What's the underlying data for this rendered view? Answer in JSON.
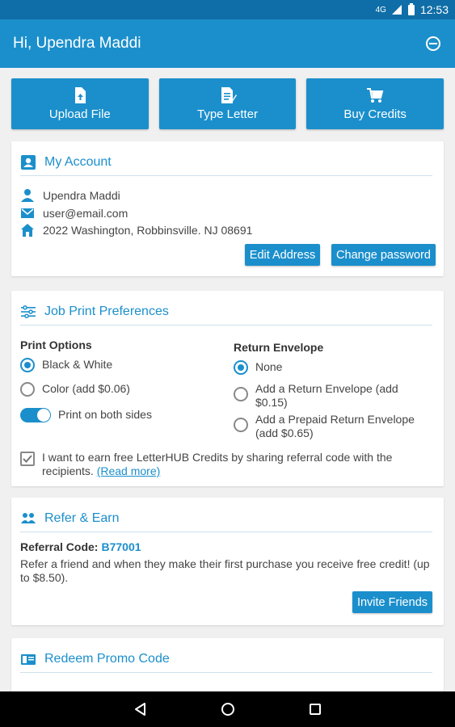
{
  "status_bar": {
    "time": "12:53",
    "network": "4G"
  },
  "app_bar": {
    "title": "Hi, Upendra Maddi",
    "logout_icon": "logout-icon"
  },
  "actions": [
    {
      "label": "Upload File",
      "icon": "upload-file-icon"
    },
    {
      "label": "Type Letter",
      "icon": "type-letter-icon"
    },
    {
      "label": "Buy Credits",
      "icon": "cart-icon"
    }
  ],
  "my_account": {
    "title": "My Account",
    "name": "Upendra Maddi",
    "email": "user@email.com",
    "address": "2022 Washington, Robbinsville. NJ 08691",
    "edit_address_label": "Edit Address",
    "change_password_label": "Change password"
  },
  "job_print": {
    "title": "Job Print Preferences",
    "print_options_label": "Print Options",
    "print_options": [
      {
        "label": "Black & White",
        "selected": true
      },
      {
        "label": "Color (add $0.06)",
        "selected": false
      }
    ],
    "both_sides_label": "Print on both sides",
    "both_sides_on": true,
    "return_envelope_label": "Return Envelope",
    "return_envelope_options": [
      {
        "label": "None",
        "selected": true
      },
      {
        "label": "Add a Return Envelope (add $0.15)",
        "selected": false
      },
      {
        "label": "Add a Prepaid Return Envelope (add $0.65)",
        "selected": false
      }
    ],
    "referral_checkbox_text": "I want to earn free LetterHUB Credits by sharing referral code with the recipients.",
    "read_more_label": "(Read more)",
    "referral_checked": true
  },
  "refer_earn": {
    "title": "Refer & Earn",
    "code_label": "Referral Code:",
    "code_value": "B77001",
    "description": "Refer a friend and when they make their first purchase you receive free credit! (up to $8.50).",
    "invite_label": "Invite Friends"
  },
  "promo": {
    "title": "Redeem Promo Code"
  },
  "colors": {
    "primary": "#1b8fcc",
    "status_bar": "#0f6ea7",
    "background": "#f0f0f0"
  }
}
